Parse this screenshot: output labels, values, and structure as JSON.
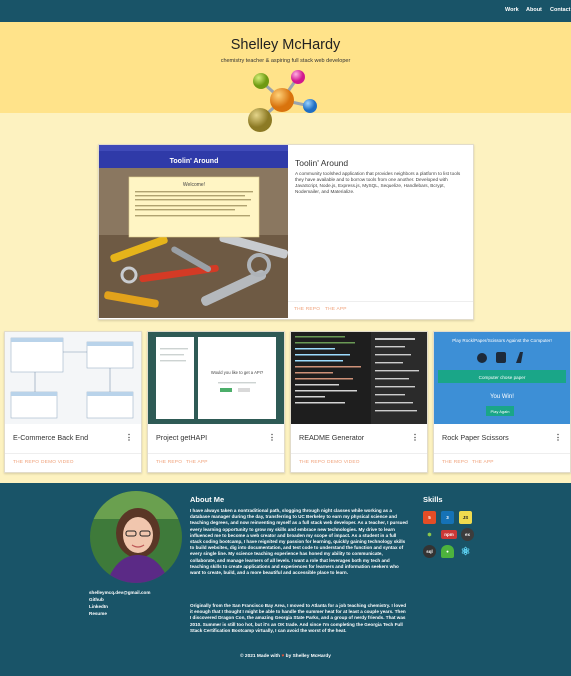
{
  "nav": {
    "links": [
      "Work",
      "About",
      "Contact"
    ]
  },
  "hero": {
    "name": "Shelley McHardy",
    "tagline": "chemistry teacher & aspiring full stack web developer"
  },
  "featured": {
    "title": "Toolin' Around",
    "description": "A community toolshed application that provides neighbors a platform to list tools they have available and to borrow tools from one another. Developed with JavaScript, Node.js, Express.js, MySQL, Sequelize, Handlebars, Bcrypt, Nodemailer, and Materialize.",
    "links": [
      "THE REPO",
      "THE APP"
    ],
    "screenshot": {
      "brand": "Toolin' Around",
      "welcome": "Welcome!"
    }
  },
  "projects": [
    {
      "title": "E-Commerce Back End",
      "links": [
        "THE REPO",
        "DEMO VIDEO"
      ]
    },
    {
      "title": "Project getHAPI",
      "links": [
        "THE REPO",
        "THE APP"
      ],
      "shot_text": "Would you like to get a API?"
    },
    {
      "title": "README Generator",
      "links": [
        "THE REPO",
        "DEMO VIDEO"
      ]
    },
    {
      "title": "Rock Paper Scissors",
      "links": [
        "THE REPO",
        "THE APP"
      ],
      "shot_title": "Play Rock/Paper/Scissors Against the Computer!",
      "shot_button": "Computer chose paper",
      "shot_result": "You Win!",
      "shot_replay": "Play Again"
    }
  ],
  "about": {
    "heading": "About Me",
    "p1": "I have always taken a nontraditional path, slogging through night classes while working as a database manager during the day, transferring to UC Berkeley to earn my physical science and teaching degrees, and now reinventing myself as a full stack web developer. As a teacher, I pursued every learning opportunity to grow my skills and embrace new technologies. My drive to learn influenced me to become a web creator and broaden my scope of impact. As a student in a full stack coding bootcamp, I have reignited my passion for learning, quickly gaining technology skills to build websites, dig into documentation, and test code to understand the function and syntax of every single line. My science teaching experience has honed my ability to communicate, collaborate, and manage learners of all levels. I want a role that leverages both my tech and teaching skills to create applications and experiences for learners and information seekers who want to create, build, and a more beautiful and accessible place to learn.",
    "p2": "Originally from the San Francisco Bay Area, I moved to Atlanta for a job teaching chemistry. I loved it enough that I thought I might be able to handle the summer heat for at least a couple years. Then I discovered Dragon Con, the amazing Georgia State Parks, and a group of nerdy friends. That was 2010. Summer is still too hot, but it's an OK trade. And since I'm completing the Georgia Tech Full Stack Certification Bootcamp virtually, I can avoid the worst of the heat."
  },
  "contact": {
    "email": "shelleymcq.dev@gmail.com",
    "links": [
      "Github",
      "LinkedIn",
      "Resume"
    ]
  },
  "skills": {
    "heading": "Skills",
    "icons": [
      "html5-icon",
      "css3-icon",
      "javascript-icon",
      "nodejs-icon",
      "npm-icon",
      "express-icon",
      "mysql-icon",
      "mongodb-icon",
      "react-icon"
    ]
  },
  "footer": {
    "made": "© 2021 Made with",
    "by": "by Shelley McHardy"
  },
  "colors": {
    "navy": "#195468",
    "hero": "#ffe38a",
    "cream": "#fdf2c0",
    "link": "#f0a27a"
  }
}
